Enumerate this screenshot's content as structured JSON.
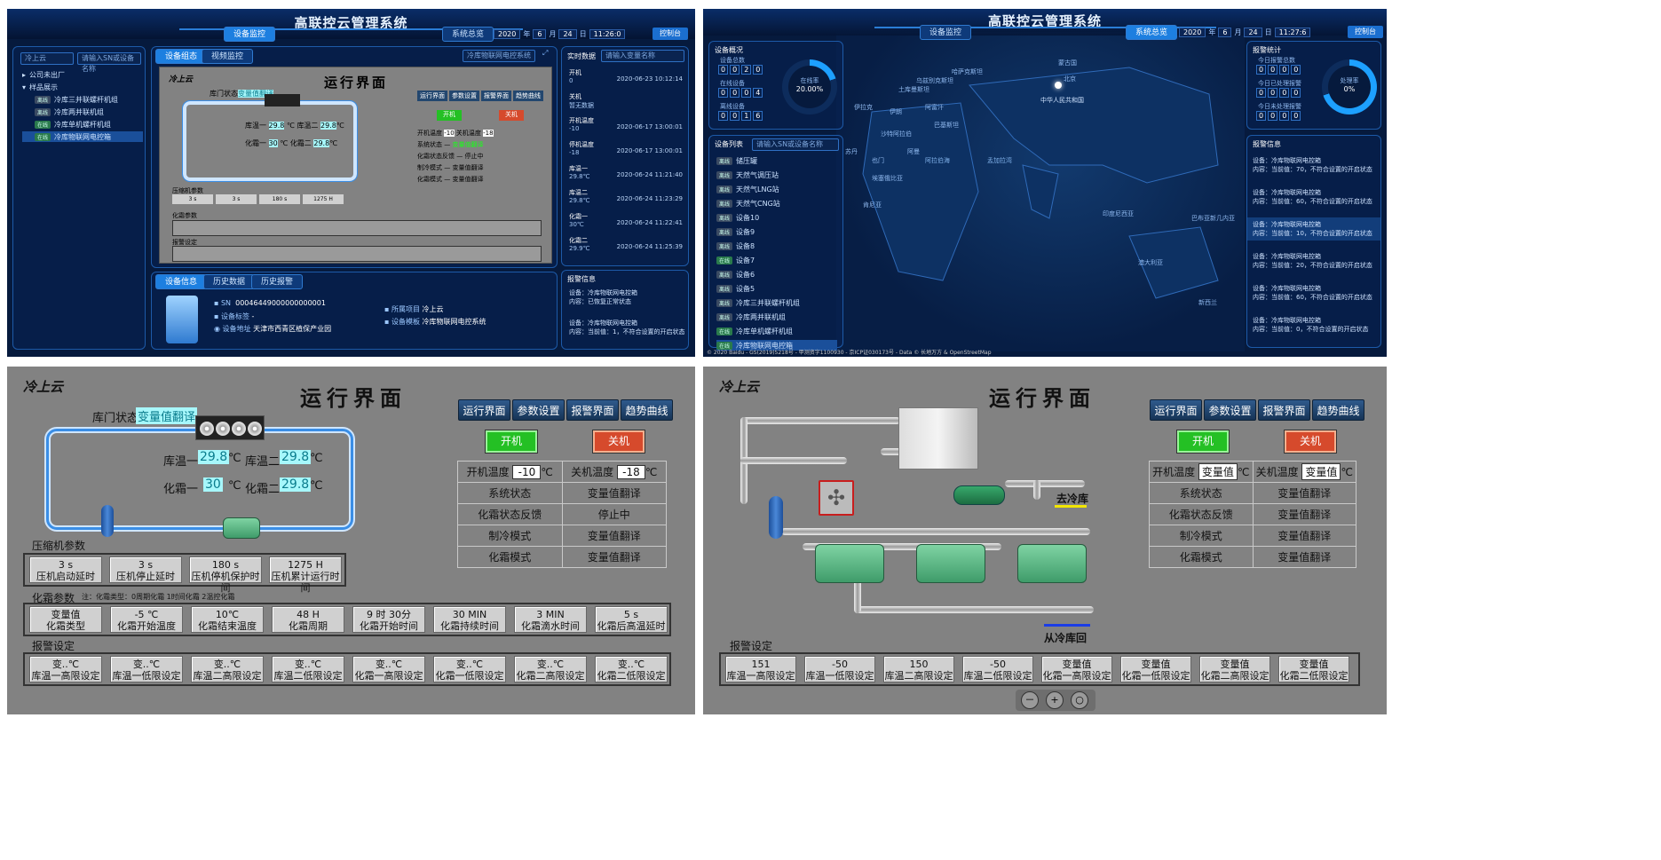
{
  "dash": {
    "system_title": "高联控云管理系统",
    "tab_device_monitor": "设备监控",
    "tab_overview": "系统总览",
    "date": {
      "year": "2020",
      "year_lbl": "年",
      "month": "6",
      "month_lbl": "月",
      "day": "24",
      "day_lbl": "日",
      "time1": "11:26:0",
      "time2": "11:27:6"
    },
    "logout": "控制台",
    "company_select": "冷上云",
    "search_sn": "请输入SN或设备名称",
    "tree": [
      "公司未出厂",
      "样品展示",
      "冷库三并联螺杆机组",
      "冷库两并联机组",
      "冷库单机螺杆机组",
      "冷库物联网电控箱"
    ],
    "tags": {
      "offline": "离线",
      "online": "在线"
    },
    "tab_device_status": "设备组态",
    "tab_video": "视频监控",
    "system_name": "冷库物联网电控系统",
    "realtime_title": "实时数据",
    "search_var": "请输入变量名称",
    "realtime": [
      {
        "name": "开机",
        "val": "0",
        "time": "2020-06-23 10:12:14"
      },
      {
        "name": "关机",
        "val": "暂无数据",
        "extra": "暂无数据",
        "time": ""
      },
      {
        "name": "开机温度",
        "val": "-10",
        "time": "2020-06-17 13:00:01"
      },
      {
        "name": "停机温度",
        "val": "-18",
        "time": "2020-06-17 13:00:01"
      },
      {
        "name": "库温一",
        "val": "29.8℃",
        "time": "2020-06-24 11:21:40"
      },
      {
        "name": "库温二",
        "val": "29.8℃",
        "time": "2020-06-24 11:23:29"
      },
      {
        "name": "化霜一",
        "val": "30℃",
        "time": "2020-06-24 11:22:41"
      },
      {
        "name": "化霜二",
        "val": "29.9℃",
        "time": "2020-06-24 11:25:39"
      }
    ],
    "tab_device_info": "设备信息",
    "tab_history": "历史数据",
    "tab_history_alarm": "历史报警",
    "sn_label": "SN",
    "sn_value": "00046449000000000001",
    "tag_label": "设备标签",
    "tag_value": "-",
    "address_label": "设备地址",
    "address_value": "天津市西青区植保产业园",
    "project_label": "所属项目",
    "project_value": "冷上云",
    "template_label": "设备模板",
    "template_value": "冷库物联网电控系统",
    "alarm_info_title": "报警信息",
    "alarm_info": [
      {
        "dev": "设备：冷库物联网电控箱",
        "msg": "内容：已恢复正常状态"
      },
      {
        "dev": "设备：冷库物联网电控箱",
        "msg": "内容：当前值：1，不符合设置的开启状态"
      }
    ]
  },
  "overview": {
    "device_overview": "设备概况",
    "device_total": "设备总数",
    "device_total_digits": [
      "0",
      "0",
      "2",
      "0"
    ],
    "online_count": "在线设备",
    "online_digits": [
      "0",
      "0",
      "0",
      "4"
    ],
    "offline_count": "离线设备",
    "offline_digits": [
      "0",
      "0",
      "1",
      "6"
    ],
    "online_rate_label": "在线率",
    "online_rate": "20.00%",
    "device_list": "设备列表",
    "search": "请输入SN或设备名称",
    "devices": [
      "储压罐",
      "天然气调压站",
      "天然气LNG站",
      "天然气CNG站",
      "设备10",
      "设备9",
      "设备8",
      "设备7",
      "设备6",
      "设备5",
      "冷库三并联螺杆机组",
      "冷库两并联机组",
      "冷库单机螺杆机组",
      "冷库物联网电控箱"
    ],
    "map_labels": [
      "中华人民共和国",
      "北京",
      "澳大利亚",
      "印度尼西亚",
      "沙特阿拉伯",
      "阿拉伯海",
      "孟加拉湾",
      "巴布亚新几内亚",
      "新西兰",
      "埃塞俄比亚",
      "土库曼斯坦",
      "蒙古国",
      "伊朗",
      "伊拉克",
      "阿富汗",
      "巴基斯坦",
      "哈萨克斯坦",
      "乌兹别克斯坦",
      "苏丹",
      "肯尼亚",
      "也门",
      "阿曼"
    ],
    "alarm_stats": "报警统计",
    "today_alarm": "今日报警总数",
    "today_alarm_digits": [
      "0",
      "0",
      "0",
      "0"
    ],
    "handled": "今日已处理报警",
    "handled_digits": [
      "0",
      "0",
      "0",
      "0"
    ],
    "unhandled": "今日未处理报警",
    "unhandled_digits": [
      "0",
      "0",
      "0",
      "0"
    ],
    "handle_rate_label": "处理率",
    "handle_rate": "0%",
    "alarm_info": "报警信息",
    "alarms": [
      {
        "dev": "设备：冷库物联网电控箱",
        "msg": "内容：当前值：70，不符合设置的开启状态"
      },
      {
        "dev": "设备：冷库物联网电控箱",
        "msg": "内容：当前值：60，不符合设置的开启状态"
      },
      {
        "dev": "设备：冷库物联网电控箱",
        "msg": "内容：当前值：10，不符合设置的开启状态"
      },
      {
        "dev": "设备：冷库物联网电控箱",
        "msg": "内容：当前值：20，不符合设置的开启状态"
      },
      {
        "dev": "设备：冷库物联网电控箱",
        "msg": "内容：当前值：60，不符合设置的开启状态"
      },
      {
        "dev": "设备：冷库物联网电控箱",
        "msg": "内容：当前值：0，不符合设置的开启状态"
      }
    ],
    "copyright": "© 2020 Baidu - GS(2019)5218号 - 甲测资字1100930 - 京ICP证030173号 - Data © 长地万方 & OpenStreetMap"
  },
  "scada": {
    "logo": "冷上云",
    "title": "运行界面",
    "door_label": "库门状态",
    "door_value": "变量值翻译",
    "t1_label": "库温一",
    "t1_value": "29.8",
    "t2_label": "库温二",
    "t2_value": "29.8",
    "d1_label": "化霜一",
    "d1_value": "30",
    "d2_label": "化霜二",
    "d2_value": "29.8",
    "unit": "℃",
    "nav": [
      "运行界面",
      "参数设置",
      "报警界面",
      "趋势曲线"
    ],
    "on_btn": "开机",
    "off_btn": "关机",
    "on_temp_label": "开机温度",
    "on_temp": "-10",
    "off_temp_label": "关机温度",
    "off_temp": "-18",
    "status_rows": [
      {
        "k": "系统状态",
        "v": "变量值翻译"
      },
      {
        "k": "化霜状态反馈",
        "v": "停止中"
      },
      {
        "k": "制冷模式",
        "v": "变量值翻译"
      },
      {
        "k": "化霜模式",
        "v": "变量值翻译"
      }
    ],
    "comp_params_title": "压缩机参数",
    "comp_params": [
      {
        "v": "3  s",
        "k": "压机启动延时"
      },
      {
        "v": "3  s",
        "k": "压机停止延时"
      },
      {
        "v": "180 s",
        "k": "压机停机保护时间"
      },
      {
        "v": "1275 H",
        "k": "压机累计运行时间"
      }
    ],
    "defrost_title": "化霜参数",
    "defrost_note": "注：化霜类型：0周期化霜   1时间化霜   2温控化霜",
    "defrost_params": [
      {
        "v": "变量值",
        "k": "化霜类型"
      },
      {
        "v": "-5 ℃",
        "k": "化霜开始温度"
      },
      {
        "v": "10℃",
        "k": "化霜结束温度"
      },
      {
        "v": "48  H",
        "k": "化霜周期"
      },
      {
        "v": "9 时 30分",
        "k": "化霜开始时间"
      },
      {
        "v": "30 MIN",
        "k": "化霜持续时间"
      },
      {
        "v": "3  MIN",
        "k": "化霜滴水时间"
      },
      {
        "v": "5  s",
        "k": "化霜后高温延时"
      }
    ],
    "alarm_title": "报警设定",
    "alarm_params": [
      {
        "v": "变..℃",
        "k": "库温一高限设定"
      },
      {
        "v": "变..℃",
        "k": "库温一低限设定"
      },
      {
        "v": "变..℃",
        "k": "库温二高限设定"
      },
      {
        "v": "变..℃",
        "k": "库温二低限设定"
      },
      {
        "v": "变..℃",
        "k": "化霜一高限设定"
      },
      {
        "v": "变..℃",
        "k": "化霜一低限设定"
      },
      {
        "v": "变..℃",
        "k": "化霜二高限设定"
      },
      {
        "v": "变..℃",
        "k": "化霜二低限设定"
      }
    ]
  },
  "scada2": {
    "logo": "冷上云",
    "title": "运行界面",
    "to_cold": "去冷库",
    "from_cold": "从冷库回",
    "nav": [
      "运行界面",
      "参数设置",
      "报警界面",
      "趋势曲线"
    ],
    "on_btn": "开机",
    "off_btn": "关机",
    "on_temp_label": "开机温度",
    "on_temp": "变量值",
    "off_temp_label": "关机温度",
    "off_temp": "变量值",
    "unit": "℃",
    "status_rows": [
      {
        "k": "系统状态",
        "v": "变量值翻译"
      },
      {
        "k": "化霜状态反馈",
        "v": "变量值翻译"
      },
      {
        "k": "制冷模式",
        "v": "变量值翻译"
      },
      {
        "k": "化霜模式",
        "v": "变量值翻译"
      }
    ],
    "alarm_title": "报警设定",
    "alarm_params": [
      {
        "v": "151",
        "k": "库温一高限设定"
      },
      {
        "v": "-50",
        "k": "库温一低限设定"
      },
      {
        "v": "150",
        "k": "库温二高限设定"
      },
      {
        "v": "-50",
        "k": "库温二低限设定"
      },
      {
        "v": "变量值",
        "k": "化霜一高限设定"
      },
      {
        "v": "变量值",
        "k": "化霜一低限设定"
      },
      {
        "v": "变量值",
        "k": "化霜二高限设定"
      },
      {
        "v": "变量值",
        "k": "化霜二低限设定"
      }
    ],
    "zoom": [
      "－",
      "+",
      "○"
    ]
  }
}
